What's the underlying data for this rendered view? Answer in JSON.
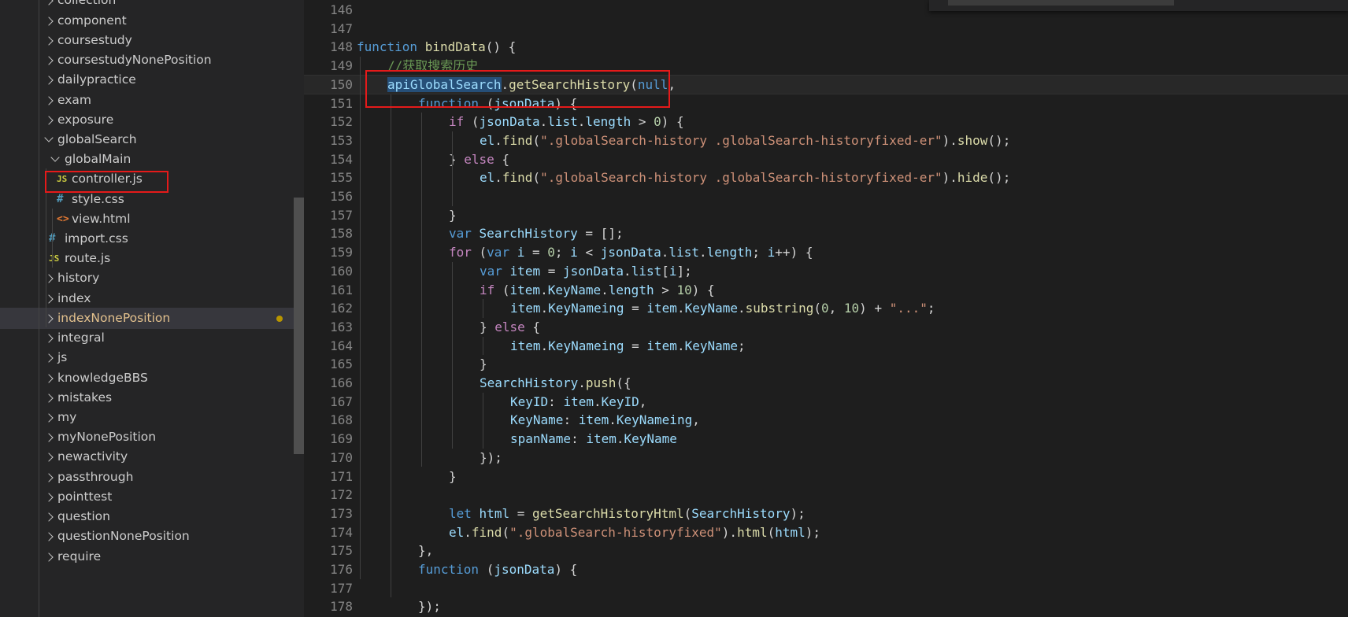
{
  "explorer": {
    "items": [
      {
        "label": "collection",
        "depth": 0,
        "type": "folder",
        "expanded": false
      },
      {
        "label": "component",
        "depth": 0,
        "type": "folder",
        "expanded": false
      },
      {
        "label": "coursestudy",
        "depth": 0,
        "type": "folder",
        "expanded": false
      },
      {
        "label": "coursestudyNonePosition",
        "depth": 0,
        "type": "folder",
        "expanded": false
      },
      {
        "label": "dailypractice",
        "depth": 0,
        "type": "folder",
        "expanded": false
      },
      {
        "label": "exam",
        "depth": 0,
        "type": "folder",
        "expanded": false
      },
      {
        "label": "exposure",
        "depth": 0,
        "type": "folder",
        "expanded": false
      },
      {
        "label": "globalSearch",
        "depth": 0,
        "type": "folder",
        "expanded": true
      },
      {
        "label": "globalMain",
        "depth": 1,
        "type": "folder",
        "expanded": true
      },
      {
        "label": "controller.js",
        "depth": 2,
        "type": "file",
        "icon": "js-file-icon"
      },
      {
        "label": "style.css",
        "depth": 2,
        "type": "file",
        "icon": "css-file-icon"
      },
      {
        "label": "view.html",
        "depth": 2,
        "type": "file",
        "icon": "html-file-icon"
      },
      {
        "label": "import.css",
        "depth": 1,
        "type": "file",
        "icon": "css-file-icon"
      },
      {
        "label": "route.js",
        "depth": 1,
        "type": "file",
        "icon": "js-file-icon"
      },
      {
        "label": "history",
        "depth": 0,
        "type": "folder",
        "expanded": false
      },
      {
        "label": "index",
        "depth": 0,
        "type": "folder",
        "expanded": false
      },
      {
        "label": "indexNonePosition",
        "depth": 0,
        "type": "folder",
        "expanded": false,
        "active": true,
        "modified": true
      },
      {
        "label": "integral",
        "depth": 0,
        "type": "folder",
        "expanded": false
      },
      {
        "label": "js",
        "depth": 0,
        "type": "folder",
        "expanded": false
      },
      {
        "label": "knowledgeBBS",
        "depth": 0,
        "type": "folder",
        "expanded": false
      },
      {
        "label": "mistakes",
        "depth": 0,
        "type": "folder",
        "expanded": false
      },
      {
        "label": "my",
        "depth": 0,
        "type": "folder",
        "expanded": false
      },
      {
        "label": "myNonePosition",
        "depth": 0,
        "type": "folder",
        "expanded": false
      },
      {
        "label": "newactivity",
        "depth": 0,
        "type": "folder",
        "expanded": false
      },
      {
        "label": "passthrough",
        "depth": 0,
        "type": "folder",
        "expanded": false
      },
      {
        "label": "pointtest",
        "depth": 0,
        "type": "folder",
        "expanded": false
      },
      {
        "label": "question",
        "depth": 0,
        "type": "folder",
        "expanded": false
      },
      {
        "label": "questionNonePosition",
        "depth": 0,
        "type": "folder",
        "expanded": false
      },
      {
        "label": "require",
        "depth": 0,
        "type": "folder",
        "expanded": false
      }
    ]
  },
  "editor": {
    "current_line": 150,
    "lines": [
      {
        "n": "146",
        "indent": 0,
        "tokens": []
      },
      {
        "n": "147",
        "indent": 0,
        "tokens": []
      },
      {
        "n": "148",
        "indent": 0,
        "tokens": [
          [
            "kw",
            "function"
          ],
          [
            "p",
            " "
          ],
          [
            "fn",
            "bindData"
          ],
          [
            "p",
            "() {"
          ]
        ]
      },
      {
        "n": "149",
        "indent": 1,
        "tokens": [
          [
            "cm",
            "//获取搜索历史"
          ]
        ]
      },
      {
        "n": "150",
        "indent": 1,
        "tokens": [
          [
            "vr hl",
            "apiGlobalSearch"
          ],
          [
            "p",
            "."
          ],
          [
            "fn",
            "getSearchHistory"
          ],
          [
            "p",
            "("
          ],
          [
            "kw",
            "null"
          ],
          [
            "p",
            ","
          ]
        ]
      },
      {
        "n": "151",
        "indent": 2,
        "tokens": [
          [
            "kw",
            "function"
          ],
          [
            "p",
            " ("
          ],
          [
            "vr",
            "jsonData"
          ],
          [
            "p",
            ") {"
          ]
        ]
      },
      {
        "n": "152",
        "indent": 3,
        "tokens": [
          [
            "ctl",
            "if"
          ],
          [
            "p",
            " ("
          ],
          [
            "vr",
            "jsonData"
          ],
          [
            "p",
            "."
          ],
          [
            "vr",
            "list"
          ],
          [
            "p",
            "."
          ],
          [
            "vr",
            "length"
          ],
          [
            "p",
            " > "
          ],
          [
            "nm",
            "0"
          ],
          [
            "p",
            ") {"
          ]
        ]
      },
      {
        "n": "153",
        "indent": 4,
        "tokens": [
          [
            "vr",
            "el"
          ],
          [
            "p",
            "."
          ],
          [
            "fn",
            "find"
          ],
          [
            "p",
            "("
          ],
          [
            "st",
            "\".globalSearch-history .globalSearch-historyfixed-er\""
          ],
          [
            "p",
            ")."
          ],
          [
            "fn",
            "show"
          ],
          [
            "p",
            "();"
          ]
        ]
      },
      {
        "n": "154",
        "indent": 3,
        "tokens": [
          [
            "p",
            "} "
          ],
          [
            "ctl",
            "else"
          ],
          [
            "p",
            " {"
          ]
        ]
      },
      {
        "n": "155",
        "indent": 4,
        "tokens": [
          [
            "vr",
            "el"
          ],
          [
            "p",
            "."
          ],
          [
            "fn",
            "find"
          ],
          [
            "p",
            "("
          ],
          [
            "st",
            "\".globalSearch-history .globalSearch-historyfixed-er\""
          ],
          [
            "p",
            ")."
          ],
          [
            "fn",
            "hide"
          ],
          [
            "p",
            "();"
          ]
        ]
      },
      {
        "n": "156",
        "indent": 0,
        "tokens": []
      },
      {
        "n": "157",
        "indent": 3,
        "tokens": [
          [
            "p",
            "}"
          ]
        ]
      },
      {
        "n": "158",
        "indent": 3,
        "tokens": [
          [
            "kw",
            "var"
          ],
          [
            "p",
            " "
          ],
          [
            "vr",
            "SearchHistory"
          ],
          [
            "p",
            " = [];"
          ]
        ]
      },
      {
        "n": "159",
        "indent": 3,
        "tokens": [
          [
            "ctl",
            "for"
          ],
          [
            "p",
            " ("
          ],
          [
            "kw",
            "var"
          ],
          [
            "p",
            " "
          ],
          [
            "vr",
            "i"
          ],
          [
            "p",
            " = "
          ],
          [
            "nm",
            "0"
          ],
          [
            "p",
            "; "
          ],
          [
            "vr",
            "i"
          ],
          [
            "p",
            " < "
          ],
          [
            "vr",
            "jsonData"
          ],
          [
            "p",
            "."
          ],
          [
            "vr",
            "list"
          ],
          [
            "p",
            "."
          ],
          [
            "vr",
            "length"
          ],
          [
            "p",
            "; "
          ],
          [
            "vr",
            "i"
          ],
          [
            "p",
            "++) {"
          ]
        ]
      },
      {
        "n": "160",
        "indent": 4,
        "tokens": [
          [
            "kw",
            "var"
          ],
          [
            "p",
            " "
          ],
          [
            "vr",
            "item"
          ],
          [
            "p",
            " = "
          ],
          [
            "vr",
            "jsonData"
          ],
          [
            "p",
            "."
          ],
          [
            "vr",
            "list"
          ],
          [
            "p",
            "["
          ],
          [
            "vr",
            "i"
          ],
          [
            "p",
            "];"
          ]
        ]
      },
      {
        "n": "161",
        "indent": 4,
        "tokens": [
          [
            "ctl",
            "if"
          ],
          [
            "p",
            " ("
          ],
          [
            "vr",
            "item"
          ],
          [
            "p",
            "."
          ],
          [
            "vr",
            "KeyName"
          ],
          [
            "p",
            "."
          ],
          [
            "vr",
            "length"
          ],
          [
            "p",
            " > "
          ],
          [
            "nm",
            "10"
          ],
          [
            "p",
            ") {"
          ]
        ]
      },
      {
        "n": "162",
        "indent": 5,
        "tokens": [
          [
            "vr",
            "item"
          ],
          [
            "p",
            "."
          ],
          [
            "vr",
            "KeyNameing"
          ],
          [
            "p",
            " = "
          ],
          [
            "vr",
            "item"
          ],
          [
            "p",
            "."
          ],
          [
            "vr",
            "KeyName"
          ],
          [
            "p",
            "."
          ],
          [
            "fn",
            "substring"
          ],
          [
            "p",
            "("
          ],
          [
            "nm",
            "0"
          ],
          [
            "p",
            ", "
          ],
          [
            "nm",
            "10"
          ],
          [
            "p",
            ") + "
          ],
          [
            "st",
            "\"...\""
          ],
          [
            "p",
            ";"
          ]
        ]
      },
      {
        "n": "163",
        "indent": 4,
        "tokens": [
          [
            "p",
            "} "
          ],
          [
            "ctl",
            "else"
          ],
          [
            "p",
            " {"
          ]
        ]
      },
      {
        "n": "164",
        "indent": 5,
        "tokens": [
          [
            "vr",
            "item"
          ],
          [
            "p",
            "."
          ],
          [
            "vr",
            "KeyNameing"
          ],
          [
            "p",
            " = "
          ],
          [
            "vr",
            "item"
          ],
          [
            "p",
            "."
          ],
          [
            "vr",
            "KeyName"
          ],
          [
            "p",
            ";"
          ]
        ]
      },
      {
        "n": "165",
        "indent": 4,
        "tokens": [
          [
            "p",
            "}"
          ]
        ]
      },
      {
        "n": "166",
        "indent": 4,
        "tokens": [
          [
            "vr",
            "SearchHistory"
          ],
          [
            "p",
            "."
          ],
          [
            "fn",
            "push"
          ],
          [
            "p",
            "({"
          ]
        ]
      },
      {
        "n": "167",
        "indent": 5,
        "tokens": [
          [
            "vr",
            "KeyID"
          ],
          [
            "p",
            ": "
          ],
          [
            "vr",
            "item"
          ],
          [
            "p",
            "."
          ],
          [
            "vr",
            "KeyID"
          ],
          [
            "p",
            ","
          ]
        ]
      },
      {
        "n": "168",
        "indent": 5,
        "tokens": [
          [
            "vr",
            "KeyName"
          ],
          [
            "p",
            ": "
          ],
          [
            "vr",
            "item"
          ],
          [
            "p",
            "."
          ],
          [
            "vr",
            "KeyNameing"
          ],
          [
            "p",
            ","
          ]
        ]
      },
      {
        "n": "169",
        "indent": 5,
        "tokens": [
          [
            "vr",
            "spanName"
          ],
          [
            "p",
            ": "
          ],
          [
            "vr",
            "item"
          ],
          [
            "p",
            "."
          ],
          [
            "vr",
            "KeyName"
          ]
        ]
      },
      {
        "n": "170",
        "indent": 4,
        "tokens": [
          [
            "p",
            "});"
          ]
        ]
      },
      {
        "n": "171",
        "indent": 3,
        "tokens": [
          [
            "p",
            "}"
          ]
        ]
      },
      {
        "n": "172",
        "indent": 0,
        "tokens": []
      },
      {
        "n": "173",
        "indent": 3,
        "tokens": [
          [
            "kw",
            "let"
          ],
          [
            "p",
            " "
          ],
          [
            "vr",
            "html"
          ],
          [
            "p",
            " = "
          ],
          [
            "fn",
            "getSearchHistoryHtml"
          ],
          [
            "p",
            "("
          ],
          [
            "vr",
            "SearchHistory"
          ],
          [
            "p",
            ");"
          ]
        ]
      },
      {
        "n": "174",
        "indent": 3,
        "tokens": [
          [
            "vr",
            "el"
          ],
          [
            "p",
            "."
          ],
          [
            "fn",
            "find"
          ],
          [
            "p",
            "("
          ],
          [
            "st",
            "\".globalSearch-historyfixed\""
          ],
          [
            "p",
            ")."
          ],
          [
            "fn",
            "html"
          ],
          [
            "p",
            "("
          ],
          [
            "vr",
            "html"
          ],
          [
            "p",
            ");"
          ]
        ]
      },
      {
        "n": "175",
        "indent": 2,
        "tokens": [
          [
            "p",
            "},"
          ]
        ]
      },
      {
        "n": "176",
        "indent": 2,
        "tokens": [
          [
            "kw",
            "function"
          ],
          [
            "p",
            " ("
          ],
          [
            "vr",
            "jsonData"
          ],
          [
            "p",
            ") {"
          ]
        ]
      },
      {
        "n": "177",
        "indent": 0,
        "tokens": []
      },
      {
        "n": "178",
        "indent": 2,
        "tokens": [
          [
            "p",
            "});"
          ]
        ]
      }
    ]
  },
  "colors": {
    "accent_annotation": "#e51a1a",
    "modified": "#e2c08d",
    "selection": "#264f78"
  }
}
